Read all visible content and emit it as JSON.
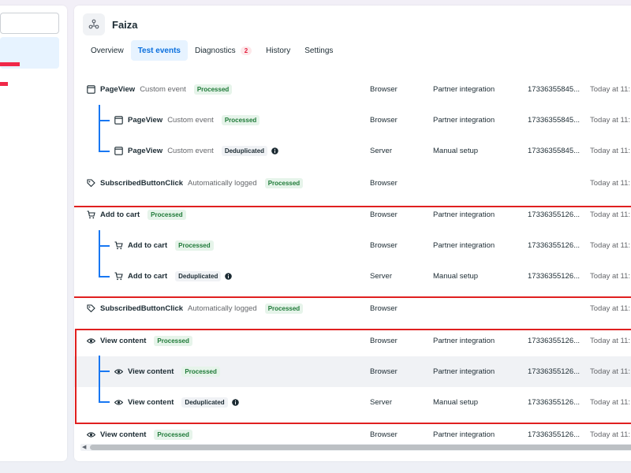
{
  "page": {
    "title": "Faiza",
    "tabs": [
      {
        "label": "Overview",
        "active": false
      },
      {
        "label": "Test events",
        "active": true
      },
      {
        "label": "Diagnostics",
        "active": false,
        "badge": "2"
      },
      {
        "label": "History",
        "active": false
      },
      {
        "label": "Settings",
        "active": false
      }
    ]
  },
  "rows": [
    {
      "name": "PageView",
      "sub": "Custom event",
      "status": "Processed",
      "source": "Browser",
      "setup": "Partner integration",
      "id": "17336355845...",
      "time": "Today at 11:",
      "icon": "window-icon"
    },
    {
      "name": "PageView",
      "sub": "Custom event",
      "status": "Processed",
      "source": "Browser",
      "setup": "Partner integration",
      "id": "17336355845...",
      "time": "Today at 11:",
      "icon": "window-icon"
    },
    {
      "name": "PageView",
      "sub": "Custom event",
      "status": "Deduplicated",
      "source": "Server",
      "setup": "Manual setup",
      "id": "17336355845...",
      "time": "Today at 11:",
      "icon": "window-icon"
    },
    {
      "name": "SubscribedButtonClick",
      "sub": "Automatically logged",
      "status": "Processed",
      "source": "Browser",
      "setup": "",
      "id": "",
      "time": "Today at 11:",
      "icon": "tag-icon"
    },
    {
      "name": "Add to cart",
      "sub": "",
      "status": "Processed",
      "source": "Browser",
      "setup": "Partner integration",
      "id": "17336355126...",
      "time": "Today at 11:",
      "icon": "cart-icon"
    },
    {
      "name": "Add to cart",
      "sub": "",
      "status": "Processed",
      "source": "Browser",
      "setup": "Partner integration",
      "id": "17336355126...",
      "time": "Today at 11:",
      "icon": "cart-icon"
    },
    {
      "name": "Add to cart",
      "sub": "",
      "status": "Deduplicated",
      "source": "Server",
      "setup": "Manual setup",
      "id": "17336355126...",
      "time": "Today at 11:",
      "icon": "cart-icon"
    },
    {
      "name": "SubscribedButtonClick",
      "sub": "Automatically logged",
      "status": "Processed",
      "source": "Browser",
      "setup": "",
      "id": "",
      "time": "Today at 11:",
      "icon": "tag-icon"
    },
    {
      "name": "View content",
      "sub": "",
      "status": "Processed",
      "source": "Browser",
      "setup": "Partner integration",
      "id": "17336355126...",
      "time": "Today at 11:",
      "icon": "eye-icon"
    },
    {
      "name": "View content",
      "sub": "",
      "status": "Processed",
      "source": "Browser",
      "setup": "Partner integration",
      "id": "17336355126...",
      "time": "Today at 11:",
      "icon": "eye-icon"
    },
    {
      "name": "View content",
      "sub": "",
      "status": "Deduplicated",
      "source": "Server",
      "setup": "Manual setup",
      "id": "17336355126...",
      "time": "Today at 11:",
      "icon": "eye-icon"
    },
    {
      "name": "View content",
      "sub": "",
      "status": "Processed",
      "source": "Browser",
      "setup": "Partner integration",
      "id": "17336355126...",
      "time": "Today at 11:",
      "icon": "eye-icon"
    }
  ],
  "colors": {
    "accent": "#1877f2",
    "highlight_border": "#e02020",
    "processed_bg": "#e6f4ea",
    "processed_text": "#1f7a38"
  }
}
